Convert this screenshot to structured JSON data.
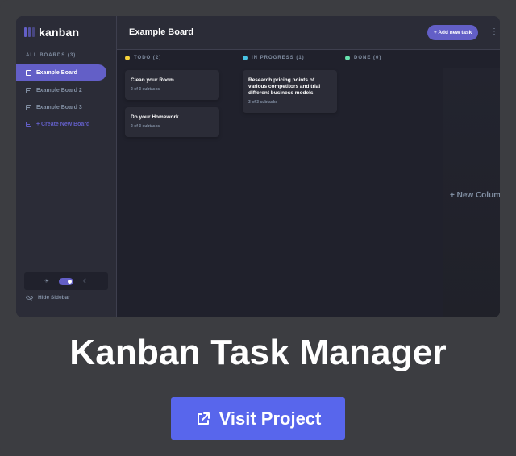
{
  "app": {
    "logo_text": "kanban"
  },
  "sidebar": {
    "boards_title": "ALL BOARDS (3)",
    "boards": [
      {
        "label": "Example Board",
        "active": true
      },
      {
        "label": "Example Board 2",
        "active": false
      },
      {
        "label": "Example Board 3",
        "active": false
      }
    ],
    "create_label": "+ Create New Board",
    "theme": {
      "light_icon": "sun-icon",
      "dark_icon": "moon-icon",
      "light_glyph": "☀",
      "dark_glyph": "☾"
    },
    "hide_label": "Hide Sidebar"
  },
  "header": {
    "board_name": "Example Board",
    "add_task_label": "+ Add new task",
    "menu_glyph": "⋮"
  },
  "columns": [
    {
      "name": "TODO (2)",
      "color": "#f7d23a",
      "tasks": [
        {
          "title": "Clean your Room",
          "subtasks": "2 of 3 subtasks"
        },
        {
          "title": "Do your Homework",
          "subtasks": "2 of 3 subtasks"
        }
      ]
    },
    {
      "name": "IN PROGRESS (1)",
      "color": "#49c4e5",
      "tasks": [
        {
          "title": "Research pricing points of various competitors and trial different business models",
          "subtasks": "3 of 3 subtasks"
        }
      ]
    },
    {
      "name": "DONE (0)",
      "color": "#67e2ae",
      "tasks": []
    }
  ],
  "new_column_label": "+ New Column",
  "caption": {
    "title": "Kanban Task Manager",
    "visit_label": "Visit Project"
  },
  "colors": {
    "accent": "#635fc7",
    "button": "#5866ec",
    "card_bg": "#3c3d41"
  }
}
